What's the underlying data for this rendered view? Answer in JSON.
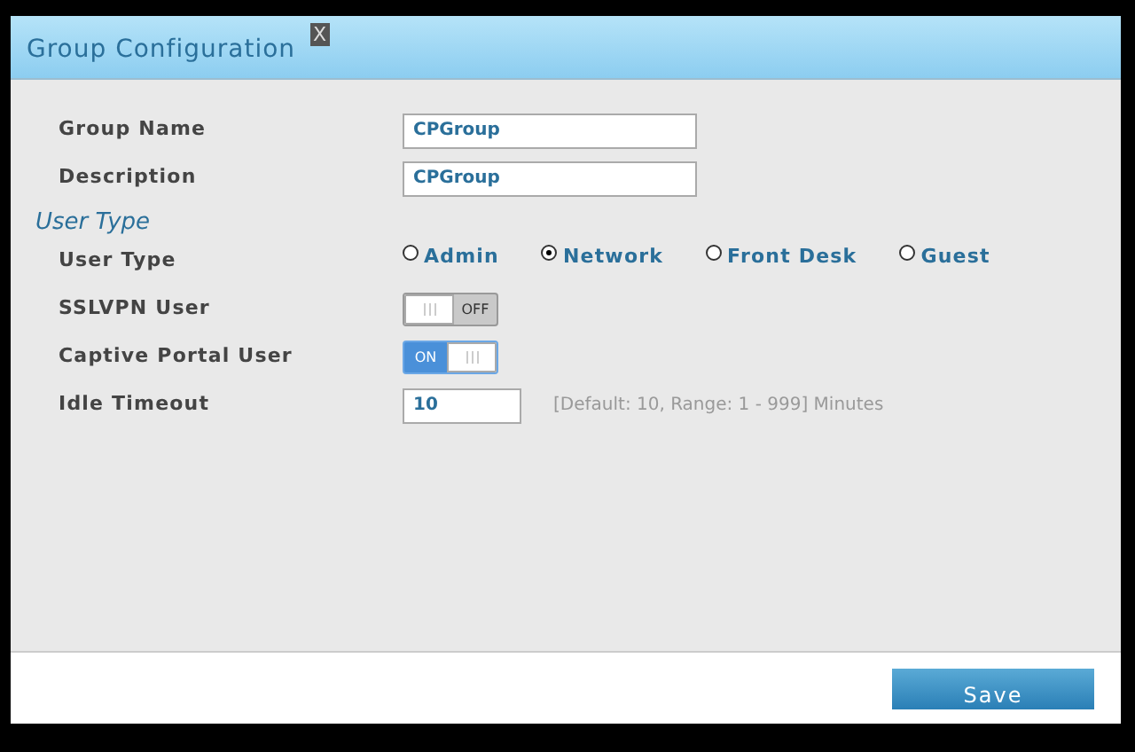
{
  "dialog": {
    "title": "Group Configuration",
    "close": "X"
  },
  "rows": [
    {
      "kind": "text",
      "label": "Group Name",
      "value": "CPGroup"
    },
    {
      "kind": "text",
      "label": "Description",
      "value": "CPGroup"
    },
    {
      "kind": "section",
      "label": "User Type"
    },
    {
      "kind": "radio",
      "label": "User Type",
      "options": [
        {
          "label": "Admin",
          "selected": false
        },
        {
          "label": "Network",
          "selected": true
        },
        {
          "label": "Front Desk",
          "selected": false
        },
        {
          "label": "Guest",
          "selected": false
        }
      ]
    },
    {
      "kind": "toggle",
      "label": "SSLVPN User",
      "on": false,
      "text": "OFF"
    },
    {
      "kind": "toggle",
      "label": "Captive Portal User",
      "on": true,
      "text": "ON"
    },
    {
      "kind": "short_text",
      "label": "Idle Timeout",
      "value": "10",
      "hint": "[Default: 10, Range: 1 - 999] Minutes"
    }
  ],
  "buttons": [
    "Save"
  ]
}
